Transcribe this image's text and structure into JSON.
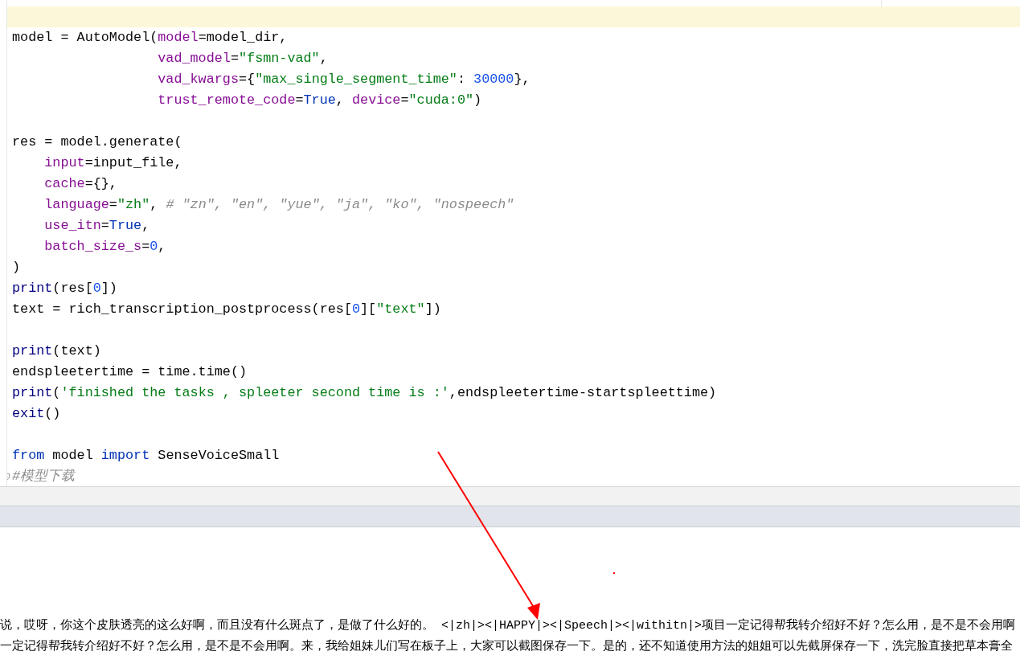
{
  "editor": {
    "lines": [
      {
        "current": true
      },
      {
        "current": false,
        "tokens": [
          {
            "text": "model = AutoModel(",
            "kind": "plain"
          },
          {
            "text": "model",
            "kind": "param"
          },
          {
            "text": "=model_dir,",
            "kind": "plain"
          }
        ]
      },
      {
        "current": false,
        "tokens": [
          {
            "text": "                  vad_model",
            "kind": "param"
          },
          {
            "text": "=",
            "kind": "plain"
          },
          {
            "text": "\"fsmn-vad\"",
            "kind": "string"
          },
          {
            "text": ",",
            "kind": "plain"
          }
        ]
      },
      {
        "current": false,
        "tokens": [
          {
            "text": "                  vad_kwargs",
            "kind": "param"
          },
          {
            "text": "={",
            "kind": "plain"
          },
          {
            "text": "\"max_single_segment_time\"",
            "kind": "string"
          },
          {
            "text": ": ",
            "kind": "plain"
          },
          {
            "text": "30000",
            "kind": "number"
          },
          {
            "text": "},",
            "kind": "plain"
          }
        ]
      },
      {
        "current": false,
        "tokens": [
          {
            "text": "                  trust_remote_code",
            "kind": "param"
          },
          {
            "text": "=",
            "kind": "plain"
          },
          {
            "text": "True",
            "kind": "keyword"
          },
          {
            "text": ", ",
            "kind": "plain"
          },
          {
            "text": "device",
            "kind": "param"
          },
          {
            "text": "=",
            "kind": "plain"
          },
          {
            "text": "\"cuda:0\"",
            "kind": "string"
          },
          {
            "text": ")",
            "kind": "plain"
          }
        ]
      },
      {
        "current": false
      },
      {
        "current": false,
        "tokens": [
          {
            "text": "res = model.generate(",
            "kind": "plain"
          }
        ]
      },
      {
        "current": false,
        "tokens": [
          {
            "text": "    input",
            "kind": "param"
          },
          {
            "text": "=input_file,",
            "kind": "plain"
          }
        ]
      },
      {
        "current": false,
        "tokens": [
          {
            "text": "    cache",
            "kind": "param"
          },
          {
            "text": "={},",
            "kind": "plain"
          }
        ]
      },
      {
        "current": false,
        "tokens": [
          {
            "text": "    language",
            "kind": "param"
          },
          {
            "text": "=",
            "kind": "plain"
          },
          {
            "text": "\"zh\"",
            "kind": "string"
          },
          {
            "text": ", ",
            "kind": "plain"
          },
          {
            "text": "# \"zn\", \"en\", \"yue\", \"ja\", \"ko\", \"nospeech\"",
            "kind": "comment"
          }
        ]
      },
      {
        "current": false,
        "tokens": [
          {
            "text": "    use_itn",
            "kind": "param"
          },
          {
            "text": "=",
            "kind": "plain"
          },
          {
            "text": "True",
            "kind": "keyword"
          },
          {
            "text": ",",
            "kind": "plain"
          }
        ]
      },
      {
        "current": false,
        "tokens": [
          {
            "text": "    batch_size_s",
            "kind": "param"
          },
          {
            "text": "=",
            "kind": "plain"
          },
          {
            "text": "0",
            "kind": "number"
          },
          {
            "text": ",",
            "kind": "plain"
          }
        ]
      },
      {
        "current": false,
        "tokens": [
          {
            "text": ")",
            "kind": "plain"
          }
        ]
      },
      {
        "current": false,
        "tokens": [
          {
            "text": "print",
            "kind": "builtin"
          },
          {
            "text": "(res[",
            "kind": "plain"
          },
          {
            "text": "0",
            "kind": "number"
          },
          {
            "text": "])",
            "kind": "plain"
          }
        ]
      },
      {
        "current": false,
        "tokens": [
          {
            "text": "text = rich_transcription_postprocess(res[",
            "kind": "plain"
          },
          {
            "text": "0",
            "kind": "number"
          },
          {
            "text": "][",
            "kind": "plain"
          },
          {
            "text": "\"text\"",
            "kind": "string"
          },
          {
            "text": "])",
            "kind": "plain"
          }
        ]
      },
      {
        "current": false
      },
      {
        "current": false,
        "tokens": [
          {
            "text": "print",
            "kind": "builtin"
          },
          {
            "text": "(text)",
            "kind": "plain"
          }
        ]
      },
      {
        "current": false,
        "tokens": [
          {
            "text": "endspleetertime = time.time()",
            "kind": "plain"
          }
        ]
      },
      {
        "current": false,
        "tokens": [
          {
            "text": "print",
            "kind": "builtin"
          },
          {
            "text": "(",
            "kind": "plain"
          },
          {
            "text": "'finished the tasks , spleeter second time is :'",
            "kind": "string"
          },
          {
            "text": ",endspleetertime-startspleettime)",
            "kind": "plain"
          }
        ]
      },
      {
        "current": false,
        "tokens": [
          {
            "text": "exit",
            "kind": "builtin"
          },
          {
            "text": "()",
            "kind": "plain"
          }
        ]
      },
      {
        "current": false
      },
      {
        "current": false,
        "tokens": [
          {
            "text": "from",
            "kind": "keyword"
          },
          {
            "text": " model ",
            "kind": "plain"
          },
          {
            "text": "import",
            "kind": "keyword"
          },
          {
            "text": " SenseVoiceSmall",
            "kind": "plain"
          }
        ]
      },
      {
        "current": false,
        "fold": true,
        "tokens": [
          {
            "text": "#模型下载",
            "kind": "comment"
          }
        ]
      }
    ]
  },
  "output": {
    "lines": [
      "说，哎呀，你这个皮肤透亮的这么好啊，而且没有什么斑点了，是做了什么好的。 <|zh|><|HAPPY|><|Speech|><|withitn|>项目一定记得帮我转介绍好不好？怎么用，是不是不会用啊",
      "一定记得帮我转介绍好不好？怎么用，是不是不会用啊。来，我给姐妹儿们写在板子上，大家可以截图保存一下。是的，还不知道使用方法的姐姐可以先截屏保存一下，洗完脸直接把草本膏全"
    ]
  }
}
